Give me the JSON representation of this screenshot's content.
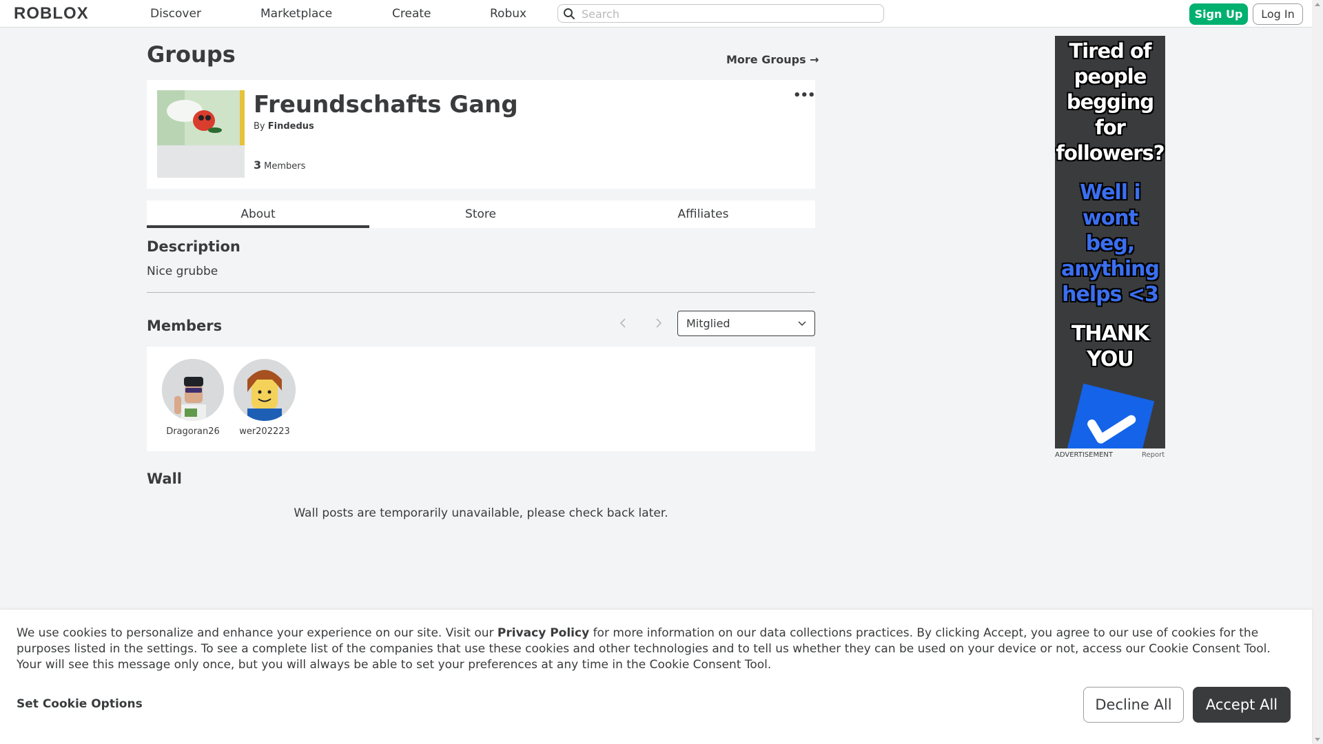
{
  "nav": {
    "logo": "ROBLOX",
    "links": [
      "Discover",
      "Marketplace",
      "Create",
      "Robux"
    ],
    "search_placeholder": "Search",
    "signup": "Sign Up",
    "login": "Log In"
  },
  "page": {
    "title": "Groups",
    "more_groups": "More Groups →"
  },
  "group": {
    "name": "Freundschafts Gang",
    "owner_prefix": "By",
    "owner": "Findedus",
    "member_count": "3",
    "member_label": "Members",
    "more_icon": "ellipsis-icon"
  },
  "tabs": [
    "About",
    "Store",
    "Affiliates"
  ],
  "description": {
    "title": "Description",
    "text": "Nice grubbe"
  },
  "members": {
    "title": "Members",
    "role_selected": "Mitglied",
    "list": [
      {
        "name": "Dragoran26"
      },
      {
        "name": "wer202223"
      }
    ]
  },
  "wall": {
    "title": "Wall",
    "message": "Wall posts are temporarily unavailable, please check back later."
  },
  "ad": {
    "line1": [
      "Tired of",
      "people",
      "begging",
      "for",
      "followers?"
    ],
    "line2": [
      "Well i",
      "wont beg,",
      "anything",
      "helps <3"
    ],
    "line3": [
      "THANK",
      "YOU"
    ],
    "label": "ADVERTISEMENT",
    "report": "Report"
  },
  "cookie": {
    "text_before": "We use cookies to personalize and enhance your experience on our site. Visit our ",
    "privacy_link": "Privacy Policy",
    "text_after": " for more information on our data collections practices. By clicking Accept, you agree to our use of cookies for the purposes listed in the settings. To see a complete list of the companies that use these cookies and other technologies and to tell us whether they can be used on your device or not, access our Cookie Consent Tool. Your will see this message only once, but you will always be able to set your preferences at any time in the Cookie Consent Tool.",
    "options": "Set Cookie Options",
    "decline": "Decline All",
    "accept": "Accept All"
  },
  "colors": {
    "accent_green": "#00b06f",
    "text": "#393b3d",
    "background": "#f2f4f5",
    "ad_blue": "#3b6ff0"
  }
}
